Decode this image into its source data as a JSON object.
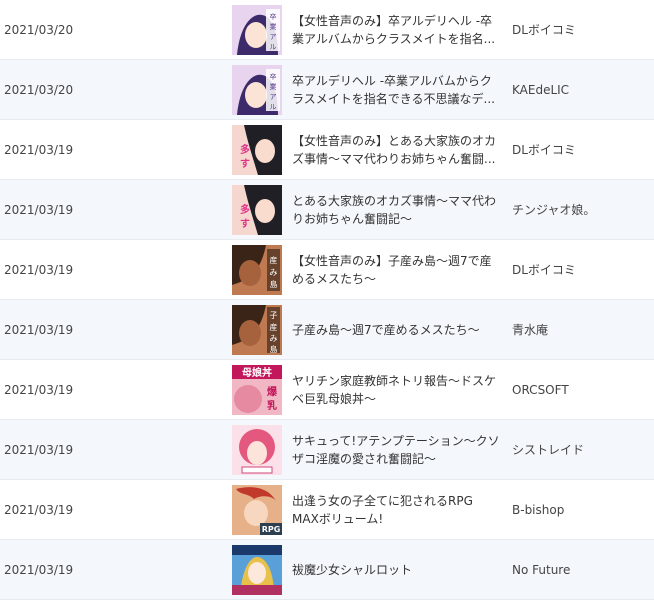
{
  "rows": [
    {
      "date": "2021/03/20",
      "title": "【女性音声のみ】卒アルデリヘル -卒業アルバムからクラスメイトを指名...",
      "circle": "DLボイコミ",
      "thumb": {
        "bg": "#e9d4ef",
        "accent": "#5b3c8f",
        "label": "卒業アルバム"
      }
    },
    {
      "date": "2021/03/20",
      "title": "卒アルデリヘル -卒業アルバムからクラスメイトを指名できる不思議なデ...",
      "circle": "KAEdeLIC",
      "thumb": {
        "bg": "#e9d4ef",
        "accent": "#5b3c8f",
        "label": "卒業アルバム"
      }
    },
    {
      "date": "2021/03/19",
      "title": "【女性音声のみ】とある大家族のオカズ事情～ママ代わりお姉ちゃん奮闘...",
      "circle": "DLボイコミ",
      "thumb": {
        "bg": "#f6d7cf",
        "accent": "#2b2b2b",
        "label": "多すぎ"
      }
    },
    {
      "date": "2021/03/19",
      "title": "とある大家族のオカズ事情～ママ代わりお姉ちゃん奮闘記～",
      "circle": "チンジャオ娘。",
      "thumb": {
        "bg": "#f6d7cf",
        "accent": "#2b2b2b",
        "label": "多すぎ"
      }
    },
    {
      "date": "2021/03/19",
      "title": "【女性音声のみ】子産み島～週7で産めるメスたち～",
      "circle": "DLボイコミ",
      "thumb": {
        "bg": "#b86b45",
        "accent": "#3a2418",
        "label": "産み島"
      }
    },
    {
      "date": "2021/03/19",
      "title": "子産み島～週7で産めるメスたち～",
      "circle": "青水庵",
      "thumb": {
        "bg": "#b86b45",
        "accent": "#3a2418",
        "label": "子産み島"
      }
    },
    {
      "date": "2021/03/19",
      "title": "ヤリチン家庭教師ネトリ報告～ドスケベ巨乳母娘丼～",
      "circle": "ORCSOFT",
      "thumb": {
        "bg": "#f2b7c4",
        "accent": "#c2185b",
        "label": "母娘丼爆乳"
      }
    },
    {
      "date": "2021/03/19",
      "title": "サキュって!アテンプテーション～クソザコ淫魔の愛され奮闘記～",
      "circle": "シストレイド",
      "thumb": {
        "bg": "#f8c7d6",
        "accent": "#d1477a",
        "label": ""
      }
    },
    {
      "date": "2021/03/19",
      "title": "出逢う女の子全てに犯されるRPG MAXボリューム!",
      "circle": "B-bishop",
      "thumb": {
        "bg": "#d99a6b",
        "accent": "#7a3b1c",
        "label": "RPG"
      }
    },
    {
      "date": "2021/03/19",
      "title": "祓魔少女シャルロット",
      "circle": "No Future",
      "thumb": {
        "bg": "#5aa0d8",
        "accent": "#e8c14a",
        "label": ""
      }
    }
  ]
}
